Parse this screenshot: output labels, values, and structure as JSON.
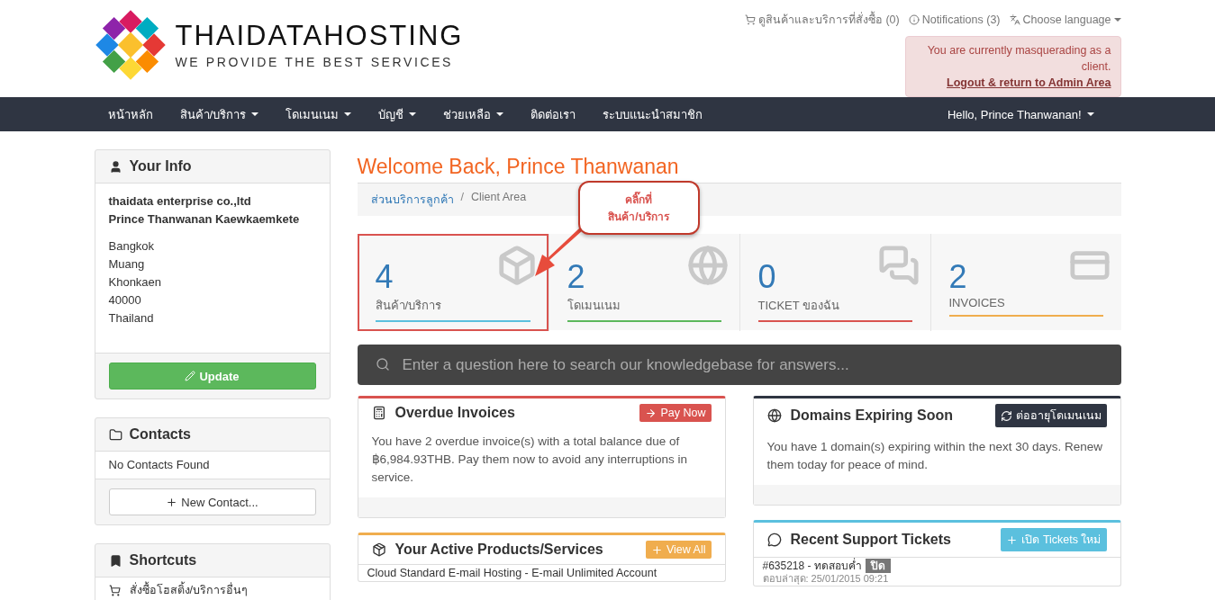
{
  "logo": {
    "name": "THAIDATAHOSTING",
    "tagline": "WE PROVIDE THE BEST SERVICES"
  },
  "top_links": [
    {
      "kind": "cart",
      "label": "ดูสินค้าและบริการที่สั่งซื้อ (0)"
    },
    {
      "kind": "info",
      "label": "Notifications (3)"
    },
    {
      "kind": "language",
      "label": "Choose language"
    }
  ],
  "masquerade": {
    "text": "You are currently masquerading as a client.",
    "link": "Logout & return to Admin Area"
  },
  "nav": {
    "items": [
      {
        "label": "หน้าหลัก",
        "dropdown": false
      },
      {
        "label": "สินค้า/บริการ",
        "dropdown": true
      },
      {
        "label": "โดเมนเนม",
        "dropdown": true
      },
      {
        "label": "บัญชี",
        "dropdown": true
      },
      {
        "label": "ช่วยเหลือ",
        "dropdown": true
      },
      {
        "label": "ติดต่อเรา",
        "dropdown": false
      },
      {
        "label": "ระบบแนะนำสมาชิก",
        "dropdown": false
      }
    ],
    "user": "Hello, Prince Thanwanan!"
  },
  "your_info": {
    "title": "Your Info",
    "company": "thaidata enterprise co.,ltd",
    "name": "Prince Thanwanan Kaewkaemkete",
    "address": [
      "Bangkok",
      "Muang",
      "Khonkaen",
      "40000",
      "Thailand"
    ],
    "button": "Update"
  },
  "contacts": {
    "title": "Contacts",
    "empty": "No Contacts Found",
    "button": "New Contact..."
  },
  "shortcuts": {
    "title": "Shortcuts",
    "items": [
      "สั่งซื้อโฮสติ้ง/บริการอื่นๆ"
    ]
  },
  "welcome": "Welcome Back, Prince Thanwanan",
  "breadcrumb_separator": "/",
  "breadcrumb": [
    {
      "label": "ส่วนบริการลูกค้า",
      "selected": false
    },
    {
      "label": "Client Area",
      "selected": true
    }
  ],
  "callout": "คลิ๊กที่\nสินค้า/บริการ",
  "stats": [
    {
      "kind": "box",
      "count": "4",
      "label": "สินค้า/บริการ",
      "color": "#5bc0de",
      "highlighted": true
    },
    {
      "kind": "globe",
      "count": "2",
      "label": "โดเมนเนม",
      "color": "#5cb85c",
      "highlighted": false
    },
    {
      "kind": "chat",
      "count": "0",
      "label": "TICKET ของฉัน",
      "color": "#d9534f",
      "highlighted": false
    },
    {
      "kind": "card",
      "count": "2",
      "label": "INVOICES",
      "color": "#f0ad4e",
      "highlighted": false
    }
  ],
  "search": {
    "placeholder": "Enter a question here to search our knowledgebase for answers..."
  },
  "panels": [
    {
      "kind": "invoices",
      "title": "Overdue Invoices",
      "button": "Pay Now",
      "color": "#d9534f",
      "body": "You have 2 overdue invoice(s) with a total balance due of ฿6,984.93THB. Pay them now to avoid any interruptions in service."
    },
    {
      "kind": "products",
      "title": "Your Active Products/Services",
      "button": "View All",
      "color": "#f0ad4e",
      "rows": [
        "Cloud Standard E-mail Hosting - E-mail Unlimited Account"
      ]
    },
    {
      "kind": "domains",
      "title": "Domains Expiring Soon",
      "button": "ต่ออายุโดเมนเนม",
      "color": "#2f3542",
      "body": "You have 1 domain(s) expiring within the next 30 days. Renew them today for peace of mind."
    },
    {
      "kind": "tickets",
      "title": "Recent Support Tickets",
      "button": "เปิด Tickets ใหม่",
      "color": "#5bc0de",
      "tickets": [
        {
          "subject": "#635218 - ทดสอบค่ำ",
          "status": "ปิด",
          "updated": "ตอบล่าสุด: 25/01/2015 09:21"
        }
      ]
    }
  ]
}
